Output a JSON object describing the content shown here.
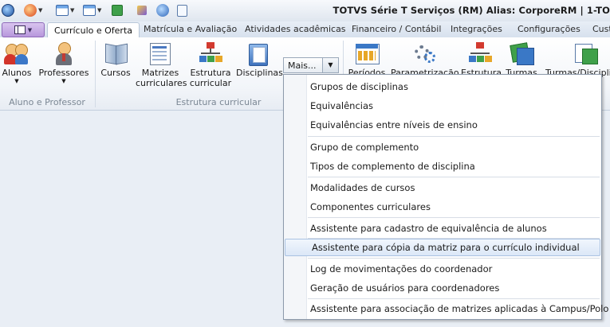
{
  "window": {
    "title": "TOTVS Série T Serviços (RM) Alias: CorporeRM | 1-TO"
  },
  "quick_access": {
    "icons": [
      "app-logo-icon",
      "globe-icon",
      "window-icon",
      "layout-icon",
      "export-icon",
      "pin-icon",
      "help-icon",
      "document-icon"
    ]
  },
  "tabs": [
    "Currículo e Oferta",
    "Matrícula e Avaliação",
    "Atividades acadêmicas",
    "Financeiro / Contábil",
    "Integrações",
    "Configurações",
    "Cust"
  ],
  "ribbon": {
    "aluno_group": {
      "label": "Aluno e Professor",
      "buttons": [
        {
          "label": "Alunos",
          "icon": "students-icon"
        },
        {
          "label": "Professores",
          "icon": "teacher-icon"
        }
      ]
    },
    "estrutura_group": {
      "label": "Estrutura curricular",
      "buttons": [
        {
          "label": "Cursos",
          "icon": "book-icon"
        },
        {
          "label": "Matrizes curriculares",
          "line1": "Matrizes",
          "line2": "curriculares",
          "icon": "matrix-icon"
        },
        {
          "label": "Estrutura curricular",
          "line1": "Estrutura",
          "line2": "curricular",
          "icon": "structure-icon"
        },
        {
          "label": "Disciplinas",
          "icon": "folder-icon"
        }
      ],
      "more_label": "Mais..."
    },
    "right_buttons": [
      {
        "label": "Períodos",
        "icon": "calendar-icon"
      },
      {
        "label": "Parametrização",
        "icon": "gears-icon"
      },
      {
        "label": "Estrutura",
        "icon": "structure-icon"
      },
      {
        "label": "Turmas",
        "icon": "class-icon"
      },
      {
        "label": "Turmas/Disciplinas",
        "icon": "class-discipline-icon"
      }
    ]
  },
  "dropdown": {
    "items": [
      "Grupos de disciplinas",
      "Equivalências",
      "Equivalências entre níveis de ensino",
      "Grupo de complemento",
      "Tipos de complemento de disciplina",
      "Modalidades de cursos",
      "Componentes curriculares",
      "Assistente para cadastro de equivalência de alunos",
      "Assistente para cópia da matriz para o currículo individual",
      "Log de movimentações do coordenador",
      "Geração de usuários para coordenadores",
      "Assistente para associação de matrizes aplicadas à Campus/Polo"
    ],
    "highlighted": "Assistente para cópia da matriz para o currículo individual"
  }
}
